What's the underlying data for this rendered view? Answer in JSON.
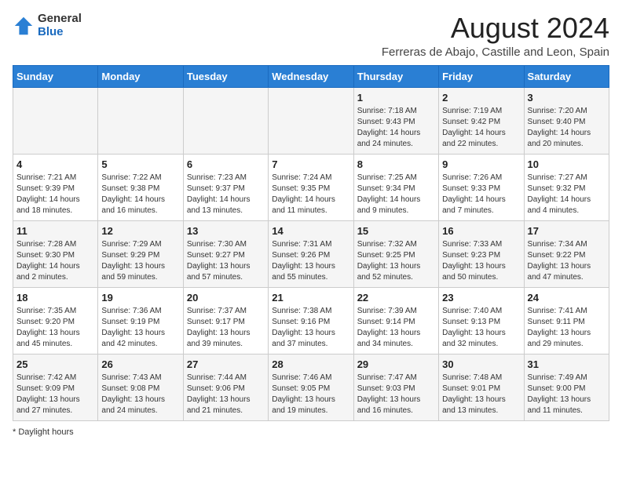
{
  "logo": {
    "general": "General",
    "blue": "Blue"
  },
  "title": "August 2024",
  "subtitle": "Ferreras de Abajo, Castille and Leon, Spain",
  "days_of_week": [
    "Sunday",
    "Monday",
    "Tuesday",
    "Wednesday",
    "Thursday",
    "Friday",
    "Saturday"
  ],
  "weeks": [
    [
      {
        "day": "",
        "info": ""
      },
      {
        "day": "",
        "info": ""
      },
      {
        "day": "",
        "info": ""
      },
      {
        "day": "",
        "info": ""
      },
      {
        "day": "1",
        "info": "Sunrise: 7:18 AM\nSunset: 9:43 PM\nDaylight: 14 hours and 24 minutes."
      },
      {
        "day": "2",
        "info": "Sunrise: 7:19 AM\nSunset: 9:42 PM\nDaylight: 14 hours and 22 minutes."
      },
      {
        "day": "3",
        "info": "Sunrise: 7:20 AM\nSunset: 9:40 PM\nDaylight: 14 hours and 20 minutes."
      }
    ],
    [
      {
        "day": "4",
        "info": "Sunrise: 7:21 AM\nSunset: 9:39 PM\nDaylight: 14 hours and 18 minutes."
      },
      {
        "day": "5",
        "info": "Sunrise: 7:22 AM\nSunset: 9:38 PM\nDaylight: 14 hours and 16 minutes."
      },
      {
        "day": "6",
        "info": "Sunrise: 7:23 AM\nSunset: 9:37 PM\nDaylight: 14 hours and 13 minutes."
      },
      {
        "day": "7",
        "info": "Sunrise: 7:24 AM\nSunset: 9:35 PM\nDaylight: 14 hours and 11 minutes."
      },
      {
        "day": "8",
        "info": "Sunrise: 7:25 AM\nSunset: 9:34 PM\nDaylight: 14 hours and 9 minutes."
      },
      {
        "day": "9",
        "info": "Sunrise: 7:26 AM\nSunset: 9:33 PM\nDaylight: 14 hours and 7 minutes."
      },
      {
        "day": "10",
        "info": "Sunrise: 7:27 AM\nSunset: 9:32 PM\nDaylight: 14 hours and 4 minutes."
      }
    ],
    [
      {
        "day": "11",
        "info": "Sunrise: 7:28 AM\nSunset: 9:30 PM\nDaylight: 14 hours and 2 minutes."
      },
      {
        "day": "12",
        "info": "Sunrise: 7:29 AM\nSunset: 9:29 PM\nDaylight: 13 hours and 59 minutes."
      },
      {
        "day": "13",
        "info": "Sunrise: 7:30 AM\nSunset: 9:27 PM\nDaylight: 13 hours and 57 minutes."
      },
      {
        "day": "14",
        "info": "Sunrise: 7:31 AM\nSunset: 9:26 PM\nDaylight: 13 hours and 55 minutes."
      },
      {
        "day": "15",
        "info": "Sunrise: 7:32 AM\nSunset: 9:25 PM\nDaylight: 13 hours and 52 minutes."
      },
      {
        "day": "16",
        "info": "Sunrise: 7:33 AM\nSunset: 9:23 PM\nDaylight: 13 hours and 50 minutes."
      },
      {
        "day": "17",
        "info": "Sunrise: 7:34 AM\nSunset: 9:22 PM\nDaylight: 13 hours and 47 minutes."
      }
    ],
    [
      {
        "day": "18",
        "info": "Sunrise: 7:35 AM\nSunset: 9:20 PM\nDaylight: 13 hours and 45 minutes."
      },
      {
        "day": "19",
        "info": "Sunrise: 7:36 AM\nSunset: 9:19 PM\nDaylight: 13 hours and 42 minutes."
      },
      {
        "day": "20",
        "info": "Sunrise: 7:37 AM\nSunset: 9:17 PM\nDaylight: 13 hours and 39 minutes."
      },
      {
        "day": "21",
        "info": "Sunrise: 7:38 AM\nSunset: 9:16 PM\nDaylight: 13 hours and 37 minutes."
      },
      {
        "day": "22",
        "info": "Sunrise: 7:39 AM\nSunset: 9:14 PM\nDaylight: 13 hours and 34 minutes."
      },
      {
        "day": "23",
        "info": "Sunrise: 7:40 AM\nSunset: 9:13 PM\nDaylight: 13 hours and 32 minutes."
      },
      {
        "day": "24",
        "info": "Sunrise: 7:41 AM\nSunset: 9:11 PM\nDaylight: 13 hours and 29 minutes."
      }
    ],
    [
      {
        "day": "25",
        "info": "Sunrise: 7:42 AM\nSunset: 9:09 PM\nDaylight: 13 hours and 27 minutes."
      },
      {
        "day": "26",
        "info": "Sunrise: 7:43 AM\nSunset: 9:08 PM\nDaylight: 13 hours and 24 minutes."
      },
      {
        "day": "27",
        "info": "Sunrise: 7:44 AM\nSunset: 9:06 PM\nDaylight: 13 hours and 21 minutes."
      },
      {
        "day": "28",
        "info": "Sunrise: 7:46 AM\nSunset: 9:05 PM\nDaylight: 13 hours and 19 minutes."
      },
      {
        "day": "29",
        "info": "Sunrise: 7:47 AM\nSunset: 9:03 PM\nDaylight: 13 hours and 16 minutes."
      },
      {
        "day": "30",
        "info": "Sunrise: 7:48 AM\nSunset: 9:01 PM\nDaylight: 13 hours and 13 minutes."
      },
      {
        "day": "31",
        "info": "Sunrise: 7:49 AM\nSunset: 9:00 PM\nDaylight: 13 hours and 11 minutes."
      }
    ]
  ],
  "footer": "Daylight hours"
}
